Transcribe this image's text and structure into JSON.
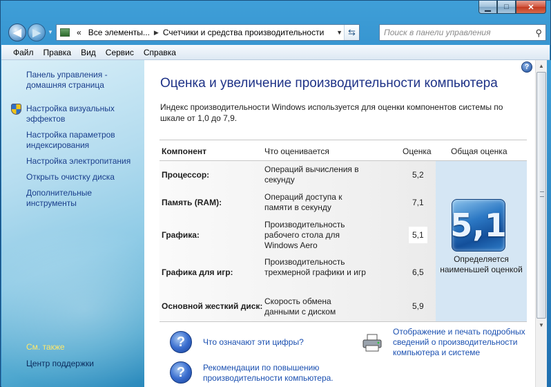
{
  "window": {
    "minimize_glyph": "▁",
    "maximize_glyph": "□",
    "close_glyph": "✕"
  },
  "nav": {
    "back_glyph": "◀",
    "forward_glyph": "▶",
    "dropdown_glyph": "▼",
    "address": {
      "prefix": "«",
      "crumbs": [
        "Все элементы...",
        "Счетчики и средства производительности"
      ],
      "separator": "▶",
      "dropdown_glyph": "▼",
      "refresh_glyph": "⇆"
    },
    "search": {
      "placeholder": "Поиск в панели управления",
      "icon_glyph": "⚲"
    }
  },
  "menu": [
    "Файл",
    "Правка",
    "Вид",
    "Сервис",
    "Справка"
  ],
  "sidebar": {
    "links": [
      "Панель управления - домашняя страница",
      "Настройка визуальных эффектов",
      "Настройка параметров индексирования",
      "Настройка электропитания",
      "Открыть очистку диска",
      "Дополнительные инструменты"
    ],
    "see_also": "См. также",
    "support": "Центр поддержки"
  },
  "main": {
    "help_glyph": "?",
    "title": "Оценка и увеличение производительности компьютера",
    "description": "Индекс производительности Windows используется для оценки компонентов системы по шкале от 1,0 до 7,9.",
    "columns": {
      "component": "Компонент",
      "what": "Что оценивается",
      "score": "Оценка",
      "overall": "Общая оценка"
    },
    "rows": [
      {
        "name": "Процессор:",
        "what": "Операций вычисления в секунду",
        "score": "5,2"
      },
      {
        "name": "Память (RAM):",
        "what": "Операций доступа к памяти в секунду",
        "score": "7,1"
      },
      {
        "name": "Графика:",
        "what": "Производительность рабочего стола для Windows Aero",
        "score": "5,1"
      },
      {
        "name": "Графика для игр:",
        "what": "Производительность трехмерной графики и игр",
        "score": "6,5"
      },
      {
        "name": "Основной жесткий диск:",
        "what": "Скорость обмена данными с диском",
        "score": "5,9"
      }
    ],
    "overall_score": "5,1",
    "overall_caption": "Определяется наименьшей оценкой",
    "links": {
      "what_numbers": "Что означают эти цифры?",
      "print_details": "Отображение и печать подробных сведений о производительности компьютера и системе",
      "recommendations": "Рекомендации по повышению производительности компьютера."
    },
    "q_glyph": "?"
  },
  "scrollbar": {
    "up_glyph": "▲",
    "down_glyph": "▼"
  }
}
